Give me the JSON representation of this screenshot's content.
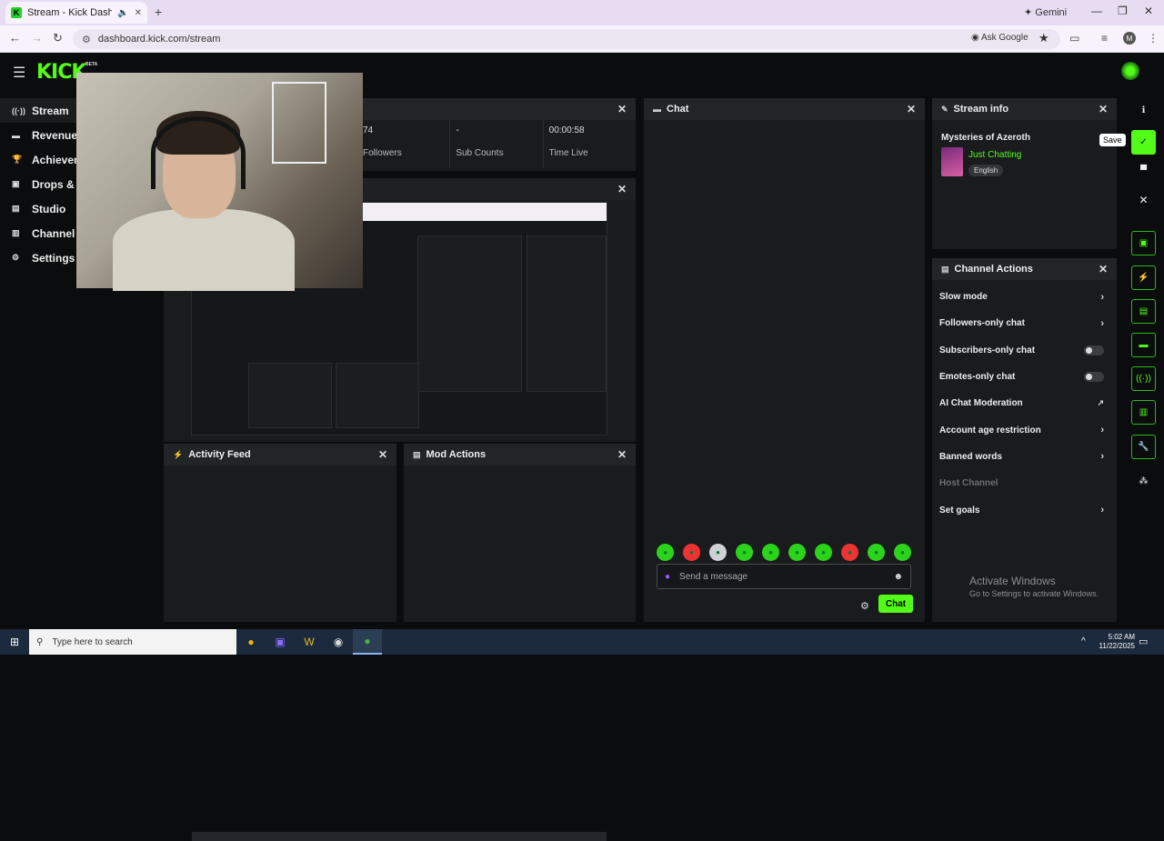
{
  "browser": {
    "tab_title": "Stream - Kick Dashboard",
    "favicon_letter": "K",
    "new_tab": "+",
    "gemini": "Gemini",
    "url": "dashboard.kick.com/stream",
    "ask_google": "Ask Google",
    "profile_initial": "M"
  },
  "app": {
    "logo": "KICK",
    "beta": "BETA"
  },
  "sidebar": {
    "items": [
      {
        "label": "Stream",
        "icon": "stream-icon"
      },
      {
        "label": "Revenue",
        "icon": "revenue-icon"
      },
      {
        "label": "Achievem",
        "icon": "trophy-icon"
      },
      {
        "label": "Drops & R",
        "icon": "gift-icon"
      },
      {
        "label": "Studio",
        "icon": "studio-icon"
      },
      {
        "label": "Channel",
        "icon": "channel-icon"
      },
      {
        "label": "Settings",
        "icon": "gear-icon"
      }
    ]
  },
  "stats": {
    "followers_value": "74",
    "followers_label": "Followers",
    "sub_value": "-",
    "sub_label": "Sub Counts",
    "time_value": "00:00:58",
    "time_label": "Time Live"
  },
  "activity_feed": {
    "title": "Activity Feed"
  },
  "mod_actions": {
    "title": "Mod Actions"
  },
  "chat": {
    "title": "Chat",
    "placeholder": "Send a message",
    "send_label": "Chat"
  },
  "stream_info": {
    "title": "Stream info",
    "stream_title": "Mysteries of Azeroth",
    "category": "Just Chatting",
    "language": "English",
    "save_tooltip": "Save"
  },
  "channel_actions": {
    "title": "Channel Actions",
    "rows": [
      {
        "label": "Slow mode",
        "control": "arrow"
      },
      {
        "label": "Followers-only chat",
        "control": "arrow"
      },
      {
        "label": "Subscribers-only chat",
        "control": "toggle"
      },
      {
        "label": "Emotes-only chat",
        "control": "toggle"
      },
      {
        "label": "AI Chat Moderation",
        "control": "external"
      },
      {
        "label": "Account age restriction",
        "control": "arrow"
      },
      {
        "label": "Banned words",
        "control": "arrow"
      },
      {
        "label": "Host Channel",
        "control": "none"
      },
      {
        "label": "Set goals",
        "control": "arrow"
      }
    ]
  },
  "activate_windows": {
    "title": "Activate Windows",
    "subtitle": "Go to Settings to activate Windows."
  },
  "taskbar": {
    "search_placeholder": "Type here to search",
    "time": "5:02 AM",
    "date": "11/22/2025"
  },
  "colors": {
    "accent": "#53fc18",
    "panel": "#191b1d",
    "background": "#0b0c0d"
  }
}
